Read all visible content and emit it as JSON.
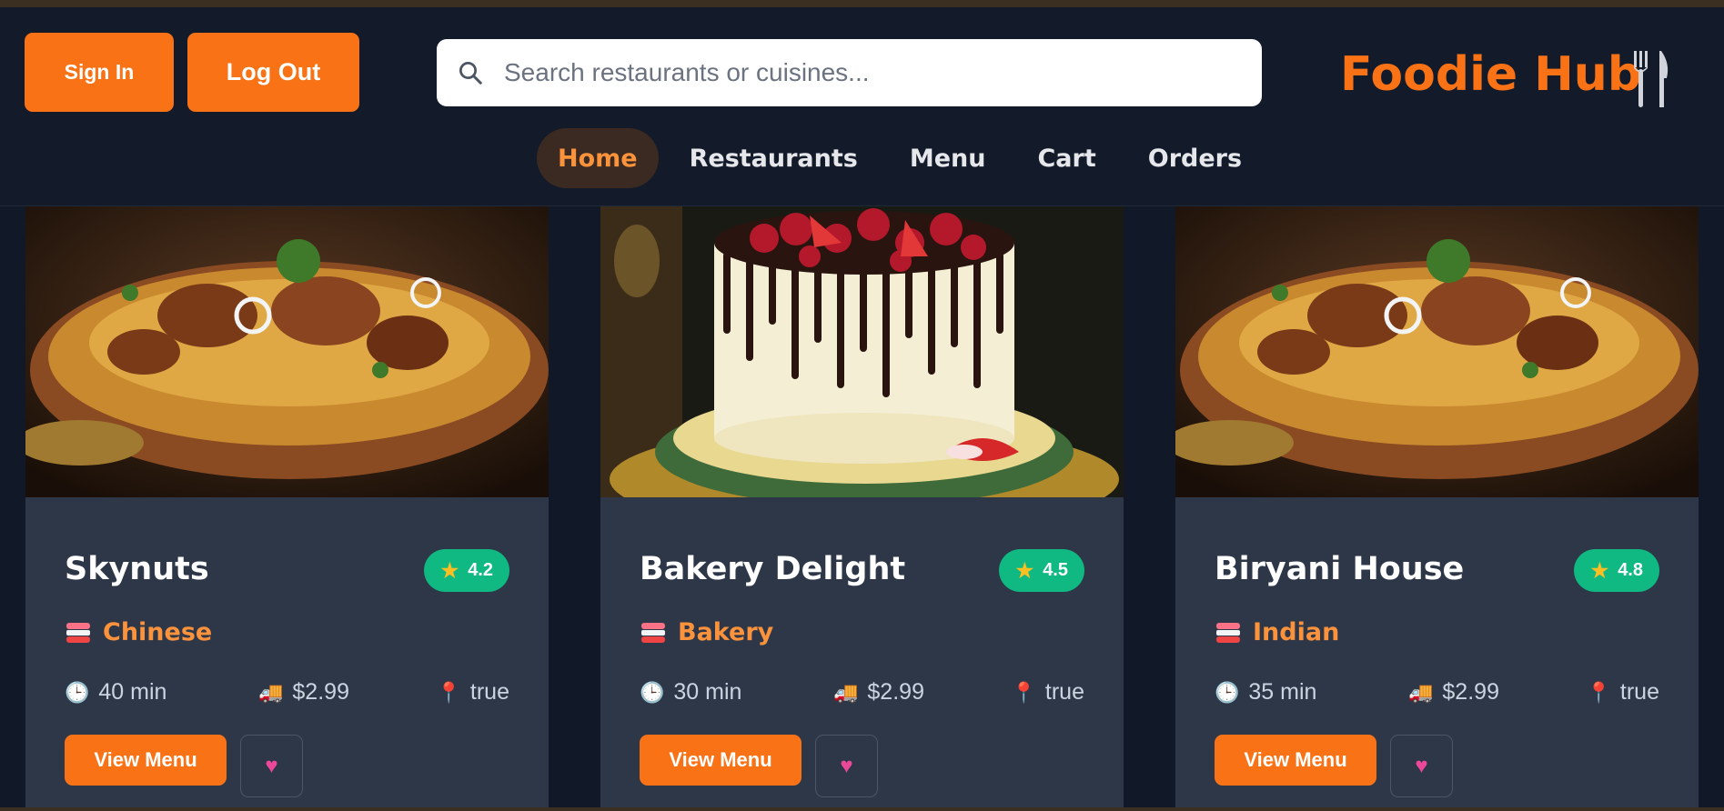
{
  "header": {
    "sign_in_label": "Sign In",
    "log_out_label": "Log Out",
    "search_placeholder": "Search restaurants or cuisines...",
    "brand_name": "Foodie Hub"
  },
  "nav": {
    "items": [
      {
        "label": "Home",
        "active": true
      },
      {
        "label": "Restaurants"
      },
      {
        "label": "Menu"
      },
      {
        "label": "Cart"
      },
      {
        "label": "Orders"
      }
    ]
  },
  "restaurants": [
    {
      "name": "Skynuts",
      "rating": "4.2",
      "cuisine": "Chinese",
      "time": "40 min",
      "fee": "$2.99",
      "location": "true",
      "view_label": "View Menu",
      "image": "biryani"
    },
    {
      "name": "Bakery Delight",
      "rating": "4.5",
      "cuisine": "Bakery",
      "time": "30 min",
      "fee": "$2.99",
      "location": "true",
      "view_label": "View Menu",
      "image": "cake"
    },
    {
      "name": "Biryani House",
      "rating": "4.8",
      "cuisine": "Indian",
      "time": "35 min",
      "fee": "$2.99",
      "location": "true",
      "view_label": "View Menu",
      "image": "biryani"
    }
  ],
  "colors": {
    "accent": "#f97316",
    "rating_badge": "#10b981",
    "card_bg": "#2e3748",
    "page_bg": "#111827"
  },
  "icons": {
    "search": "search-icon",
    "brand": "fork-knife-icon",
    "star": "star-icon",
    "cuisine": "sushi-icon",
    "time": "clock-icon",
    "fee": "delivery-truck-icon",
    "location": "pin-icon",
    "favorite": "heart-icon"
  }
}
